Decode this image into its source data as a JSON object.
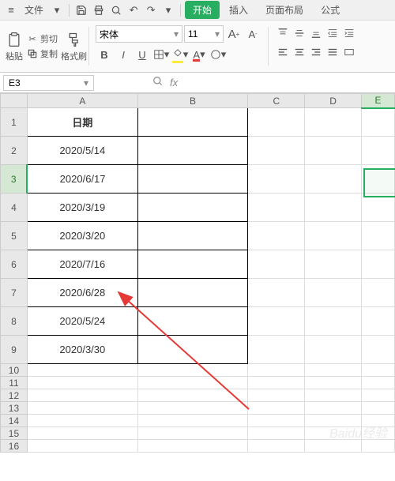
{
  "menubar": {
    "file_label": "文件",
    "tabs": {
      "start": "开始",
      "insert": "插入",
      "layout": "页面布局",
      "formula": "公式"
    }
  },
  "ribbon": {
    "clipboard": {
      "cut": "剪切",
      "copy": "复制",
      "paste": "粘贴",
      "format_painter": "格式刷"
    },
    "font": {
      "name": "宋体",
      "size": "11",
      "bold": "B",
      "italic": "I",
      "underline": "U"
    },
    "size_up": "A",
    "size_down": "A"
  },
  "formula_bar": {
    "name_box": "E3",
    "fx": "fx"
  },
  "columns": [
    "A",
    "B",
    "C",
    "D",
    "E"
  ],
  "selected_col": "E",
  "selected_row": "3",
  "table": {
    "header": "日期",
    "rows": [
      "2020/5/14",
      "2020/6/17",
      "2020/3/19",
      "2020/3/20",
      "2020/7/16",
      "2020/6/28",
      "2020/5/24",
      "2020/3/30"
    ]
  },
  "row_numbers": [
    "1",
    "2",
    "3",
    "4",
    "5",
    "6",
    "7",
    "8",
    "9",
    "10",
    "11",
    "12",
    "13",
    "14",
    "15",
    "16"
  ],
  "watermark": "Baidu经验"
}
